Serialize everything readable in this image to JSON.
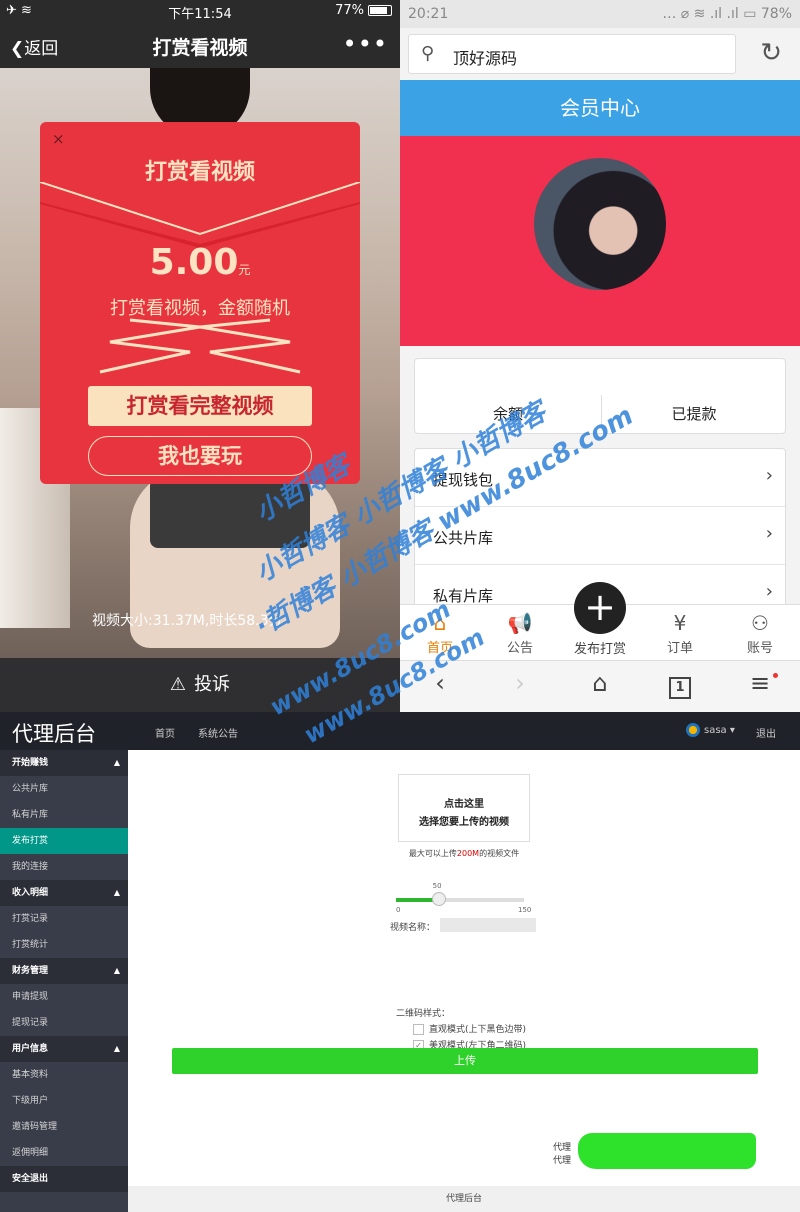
{
  "left_phone": {
    "status": {
      "carrier_icon": "airplane-icon",
      "time": "下午11:54",
      "battery": "77%"
    },
    "nav": {
      "back_label": "返回",
      "title": "打赏看视频",
      "more_label": "•••"
    },
    "video_info": "视频大小:31.37M,时长58.3分",
    "redpacket": {
      "title": "打赏看视频",
      "amount": "5.00",
      "currency": "元",
      "description": "打赏看视频，金额随机",
      "primary_button": "打赏看完整视频",
      "secondary_button": "我也要玩",
      "close_label": "×"
    },
    "report_label": "投诉"
  },
  "right_phone": {
    "status": {
      "time": "20:21",
      "battery": "78%"
    },
    "search": {
      "query": "顶好源码"
    },
    "header_title": "会员中心",
    "stats": {
      "balance_label": "余额",
      "withdrawn_label": "已提款"
    },
    "menu": [
      {
        "label": "提现钱包"
      },
      {
        "label": "公共片库"
      },
      {
        "label": "私有片库"
      }
    ],
    "tabs": [
      {
        "label": "首页",
        "icon": "home-icon"
      },
      {
        "label": "公告",
        "icon": "megaphone-icon"
      },
      {
        "label": "订单",
        "icon": "order-icon"
      },
      {
        "label": "账号",
        "icon": "user-icon"
      }
    ],
    "publish_label": "发布打赏",
    "browser": {
      "tab_count": "1"
    }
  },
  "admin": {
    "brand": "代理后台",
    "nav": [
      "首页",
      "系统公告"
    ],
    "user": "sasa",
    "logout": "退出",
    "sidebar": [
      {
        "group": "开始赚钱",
        "items": [
          "公共片库",
          "私有片库",
          "发布打赏",
          "我的连接"
        ]
      },
      {
        "group": "收入明细",
        "items": [
          "打赏记录",
          "打赏统计"
        ]
      },
      {
        "group": "财务管理",
        "items": [
          "申请提现",
          "提现记录"
        ]
      },
      {
        "group": "用户信息",
        "items": [
          "基本资料",
          "下级用户",
          "邀请码管理",
          "返佣明细"
        ]
      }
    ],
    "sidebar_bottom": "安全退出",
    "active_item": "发布打赏",
    "upload_box": {
      "line1": "点击这里",
      "line2": "选择您要上传的视频"
    },
    "hint": {
      "pre": "最大可以上传",
      "size": "200M",
      "post": "的视频文件"
    },
    "slider": {
      "value": 50,
      "min": 0,
      "max": 150
    },
    "video_name_label": "视频名称：",
    "qr_label": "二维码样式：",
    "qr_options": [
      {
        "label": "直观模式(上下黑色边带)",
        "checked": false
      },
      {
        "label": "美观模式(左下角二维码)",
        "checked": true
      }
    ],
    "upload_button": "上传",
    "agent_lines": [
      "代理",
      "代理"
    ],
    "footer": "代理后台"
  },
  "watermark": {
    "lines": [
      "小哲博客",
      "小哲博客 小哲博客 小哲博客",
      "·哲博客 小哲博客 www.8uc8.com",
      "www.8uc8.com",
      "www.8uc8.com"
    ],
    "color": "#2f80d8"
  },
  "colors": {
    "redpacket": "#e8343f",
    "member_header": "#3aa2e5",
    "member_pink": "#f0304e",
    "admin_active": "#009688",
    "upload_green": "#2ed22a"
  }
}
